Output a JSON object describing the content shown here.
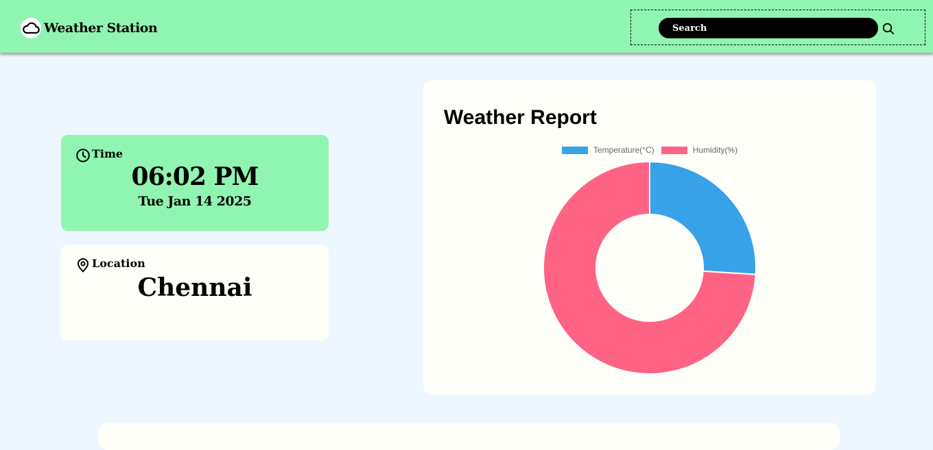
{
  "header": {
    "brand_title": "Weather Station",
    "brand_icon": "cloud-icon",
    "search_placeholder": "Search",
    "search_icon": "search-icon"
  },
  "time_card": {
    "label": "Time",
    "icon": "clock-icon",
    "time": "06:02 PM",
    "date": "Tue Jan 14 2025"
  },
  "location_card": {
    "label": "Location",
    "icon": "location-pin-icon",
    "city": "Chennai"
  },
  "report": {
    "title": "Weather Report"
  },
  "chart_data": {
    "type": "doughnut",
    "categories": [
      "Temperature(°C)",
      "Humidity(%)"
    ],
    "values": [
      26,
      74
    ],
    "colors": [
      "#38a2e8",
      "#ff6384"
    ],
    "legend_position": "top"
  },
  "colors": {
    "navbar": "#90f5b0",
    "page_bg": "#eef6ff",
    "card_bg": "#fefff9"
  }
}
